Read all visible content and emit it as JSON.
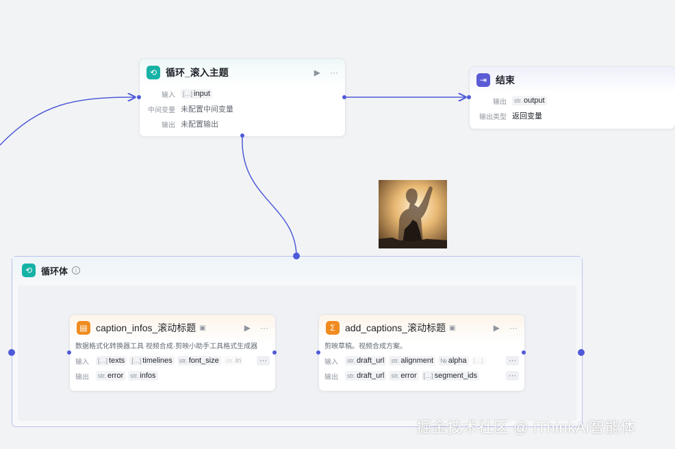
{
  "loop_node": {
    "title": "循环_滚入主题",
    "rows": [
      {
        "label": "输入",
        "chips": [
          {
            "type": "[…]",
            "name": "input"
          }
        ],
        "value": ""
      },
      {
        "label": "中间变量",
        "chips": [],
        "value": "未配置中间变量"
      },
      {
        "label": "输出",
        "chips": [],
        "value": "未配置输出"
      }
    ]
  },
  "end_node": {
    "title": "结束",
    "rows": [
      {
        "label": "输出",
        "chips": [
          {
            "type": "str.",
            "name": "output"
          }
        ],
        "value": ""
      },
      {
        "label": "输出类型",
        "chips": [],
        "value": "返回变量"
      }
    ]
  },
  "loop_body": {
    "title": "循环体",
    "info_icon": "info-icon"
  },
  "caption_node": {
    "title": "caption_infos_滚动标题",
    "description": "数据格式化转换器工具 视频合成·剪映小助手工具格式生成器",
    "inputs": [
      {
        "type": "[…]",
        "name": "texts"
      },
      {
        "type": "[…]",
        "name": "timelines"
      },
      {
        "type": "str.",
        "name": "font_size"
      },
      {
        "type": "str.",
        "name": "in"
      }
    ],
    "outputs": [
      {
        "type": "str.",
        "name": "error"
      },
      {
        "type": "str.",
        "name": "infos"
      }
    ],
    "input_label": "输入",
    "output_label": "输出",
    "more": "···"
  },
  "add_node": {
    "title": "add_captions_滚动标题",
    "description": "剪映草稿。视频合成方案。",
    "inputs": [
      {
        "type": "str.",
        "name": "draft_url"
      },
      {
        "type": "str.",
        "name": "alignment"
      },
      {
        "type": "№",
        "name": "alpha"
      },
      {
        "type": "[…]",
        "name": ""
      }
    ],
    "outputs": [
      {
        "type": "str.",
        "name": "draft_url"
      },
      {
        "type": "str.",
        "name": "error"
      },
      {
        "type": "[…]",
        "name": "segment_ids"
      }
    ],
    "input_label": "输入",
    "output_label": "输出",
    "more": "···"
  },
  "watermark": "掘金技术社区 @ iThinkAi智能体",
  "colors": {
    "wire": "#4e5ad8",
    "teal": "#17b2a6",
    "purple": "#5b5bd6",
    "orange": "#f08b1f"
  }
}
